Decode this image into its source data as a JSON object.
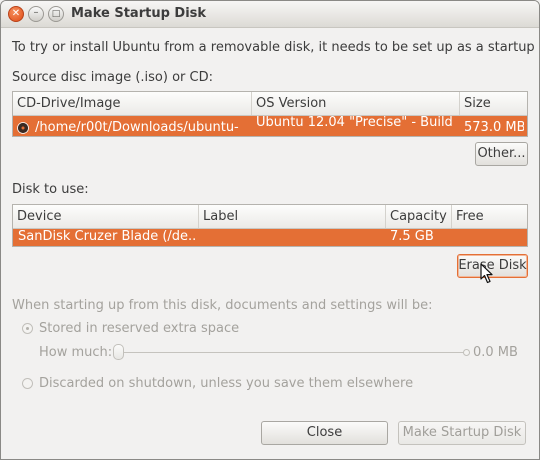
{
  "window": {
    "title": "Make Startup Disk"
  },
  "intro_text": "To try or install Ubuntu from a removable disk, it needs to be set up as a startup disk.",
  "source": {
    "label": "Source disc image (.iso) or CD:",
    "columns": [
      "CD-Drive/Image",
      "OS Version",
      "Size"
    ],
    "row": {
      "image": "/home/r00t/Downloads/ubuntu-",
      "os_version": "Ubuntu 12.04 \"Precise\" - Build ...",
      "size": "573.0 MB"
    },
    "other_button": "Other..."
  },
  "disk": {
    "label": "Disk to use:",
    "columns": [
      "Device",
      "Label",
      "Capacity",
      "Free Space"
    ],
    "row": {
      "device": "SanDisk Cruzer Blade (/de...",
      "label": "",
      "capacity": "7.5 GB",
      "free_space": ""
    },
    "erase_button": "Erase Disk"
  },
  "persistence": {
    "heading": "When starting up from this disk, documents and settings will be:",
    "option_stored": "Stored in reserved extra space",
    "how_much_label": "How much:",
    "how_much_value": "0.0 MB",
    "slider_fraction": 0,
    "option_discarded": "Discarded on shutdown, unless you save them elsewhere"
  },
  "buttons": {
    "close": "Close",
    "make": "Make Startup Disk"
  },
  "icons": {
    "close": "close-icon",
    "minimize": "minimize-icon",
    "maximize": "maximize-icon",
    "cd": "cd-icon",
    "cursor": "mouse-pointer-icon"
  },
  "colors": {
    "accent": "#e46f35"
  }
}
